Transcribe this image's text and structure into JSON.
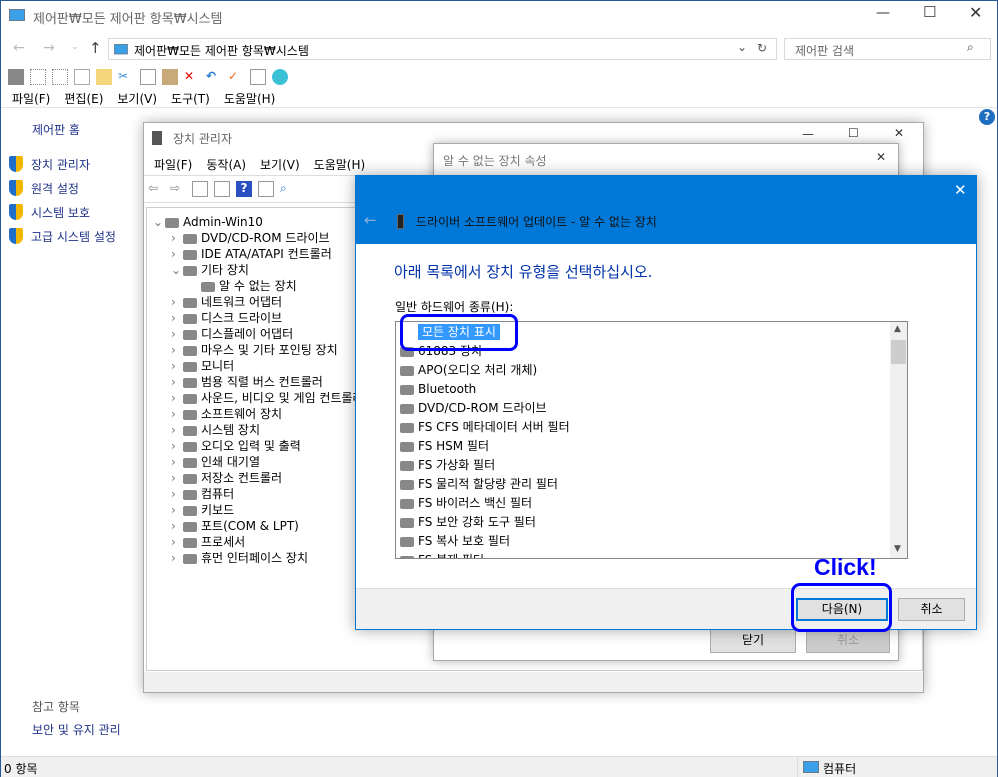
{
  "main": {
    "title": "제어판₩모든 제어판 항목₩시스템",
    "address": "제어판₩모든 제어판 항목₩시스템",
    "search_placeholder": "제어판 검색",
    "menu": [
      "파일(F)",
      "편집(E)",
      "보기(V)",
      "도구(T)",
      "도움말(H)"
    ],
    "sidebar": {
      "home": "제어판 홈",
      "links": [
        "장치 관리자",
        "원격 설정",
        "시스템 보호",
        "고급 시스템 설정"
      ],
      "see_also": "참고 항목",
      "see_also_link": "보안 및 유지 관리"
    },
    "status": {
      "items": "0 항목",
      "location": "컴퓨터"
    }
  },
  "devmgr": {
    "title": "장치 관리자",
    "menu": [
      "파일(F)",
      "동작(A)",
      "보기(V)",
      "도움말(H)"
    ],
    "tree": [
      {
        "label": "Admin-Win10",
        "level": 0,
        "exp": "v"
      },
      {
        "label": "DVD/CD-ROM 드라이브",
        "level": 1,
        "exp": ">"
      },
      {
        "label": "IDE ATA/ATAPI 컨트롤러",
        "level": 1,
        "exp": ">"
      },
      {
        "label": "기타 장치",
        "level": 1,
        "exp": "v"
      },
      {
        "label": "알 수 없는 장치",
        "level": 2,
        "exp": ""
      },
      {
        "label": "네트워크 어댑터",
        "level": 1,
        "exp": ">"
      },
      {
        "label": "디스크 드라이브",
        "level": 1,
        "exp": ">"
      },
      {
        "label": "디스플레이 어댑터",
        "level": 1,
        "exp": ">"
      },
      {
        "label": "마우스 및 기타 포인팅 장치",
        "level": 1,
        "exp": ">"
      },
      {
        "label": "모니터",
        "level": 1,
        "exp": ">"
      },
      {
        "label": "범용 직렬 버스 컨트롤러",
        "level": 1,
        "exp": ">"
      },
      {
        "label": "사운드, 비디오 및 게임 컨트롤러",
        "level": 1,
        "exp": ">"
      },
      {
        "label": "소프트웨어 장치",
        "level": 1,
        "exp": ">"
      },
      {
        "label": "시스템 장치",
        "level": 1,
        "exp": ">"
      },
      {
        "label": "오디오 입력 및 출력",
        "level": 1,
        "exp": ">"
      },
      {
        "label": "인쇄 대기열",
        "level": 1,
        "exp": ">"
      },
      {
        "label": "저장소 컨트롤러",
        "level": 1,
        "exp": ">"
      },
      {
        "label": "컴퓨터",
        "level": 1,
        "exp": ">"
      },
      {
        "label": "키보드",
        "level": 1,
        "exp": ">"
      },
      {
        "label": "포트(COM & LPT)",
        "level": 1,
        "exp": ">"
      },
      {
        "label": "프로세서",
        "level": 1,
        "exp": ">"
      },
      {
        "label": "휴먼 인터페이스 장치",
        "level": 1,
        "exp": ">"
      }
    ]
  },
  "props": {
    "title": "알 수 없는 장치 속성",
    "close": "닫기",
    "cancel": "취소"
  },
  "wizard": {
    "title": "드라이버 소프트웨어 업데이트 - 알 수 없는 장치",
    "heading": "아래 목록에서 장치 유형을 선택하십시오.",
    "list_label": "일반 하드웨어 종류(H):",
    "items": [
      "모든 장치 표시",
      "61883 장치",
      "APO(오디오 처리 개체)",
      "Bluetooth",
      "DVD/CD-ROM 드라이브",
      "FS CFS 메타데이터 서버 필터",
      "FS HSM 필터",
      "FS 가상화 필터",
      "FS 물리적 할당량 관리 필터",
      "FS 바이러스 백신 필터",
      "FS 보안 강화 도구 필터",
      "FS 복사 보호 필터",
      "FS 복제 필터"
    ],
    "next": "다음(N)",
    "cancel": "취소",
    "accent": "#0078d7"
  },
  "annotation": {
    "text": "Click!",
    "color": "#0000ff"
  }
}
